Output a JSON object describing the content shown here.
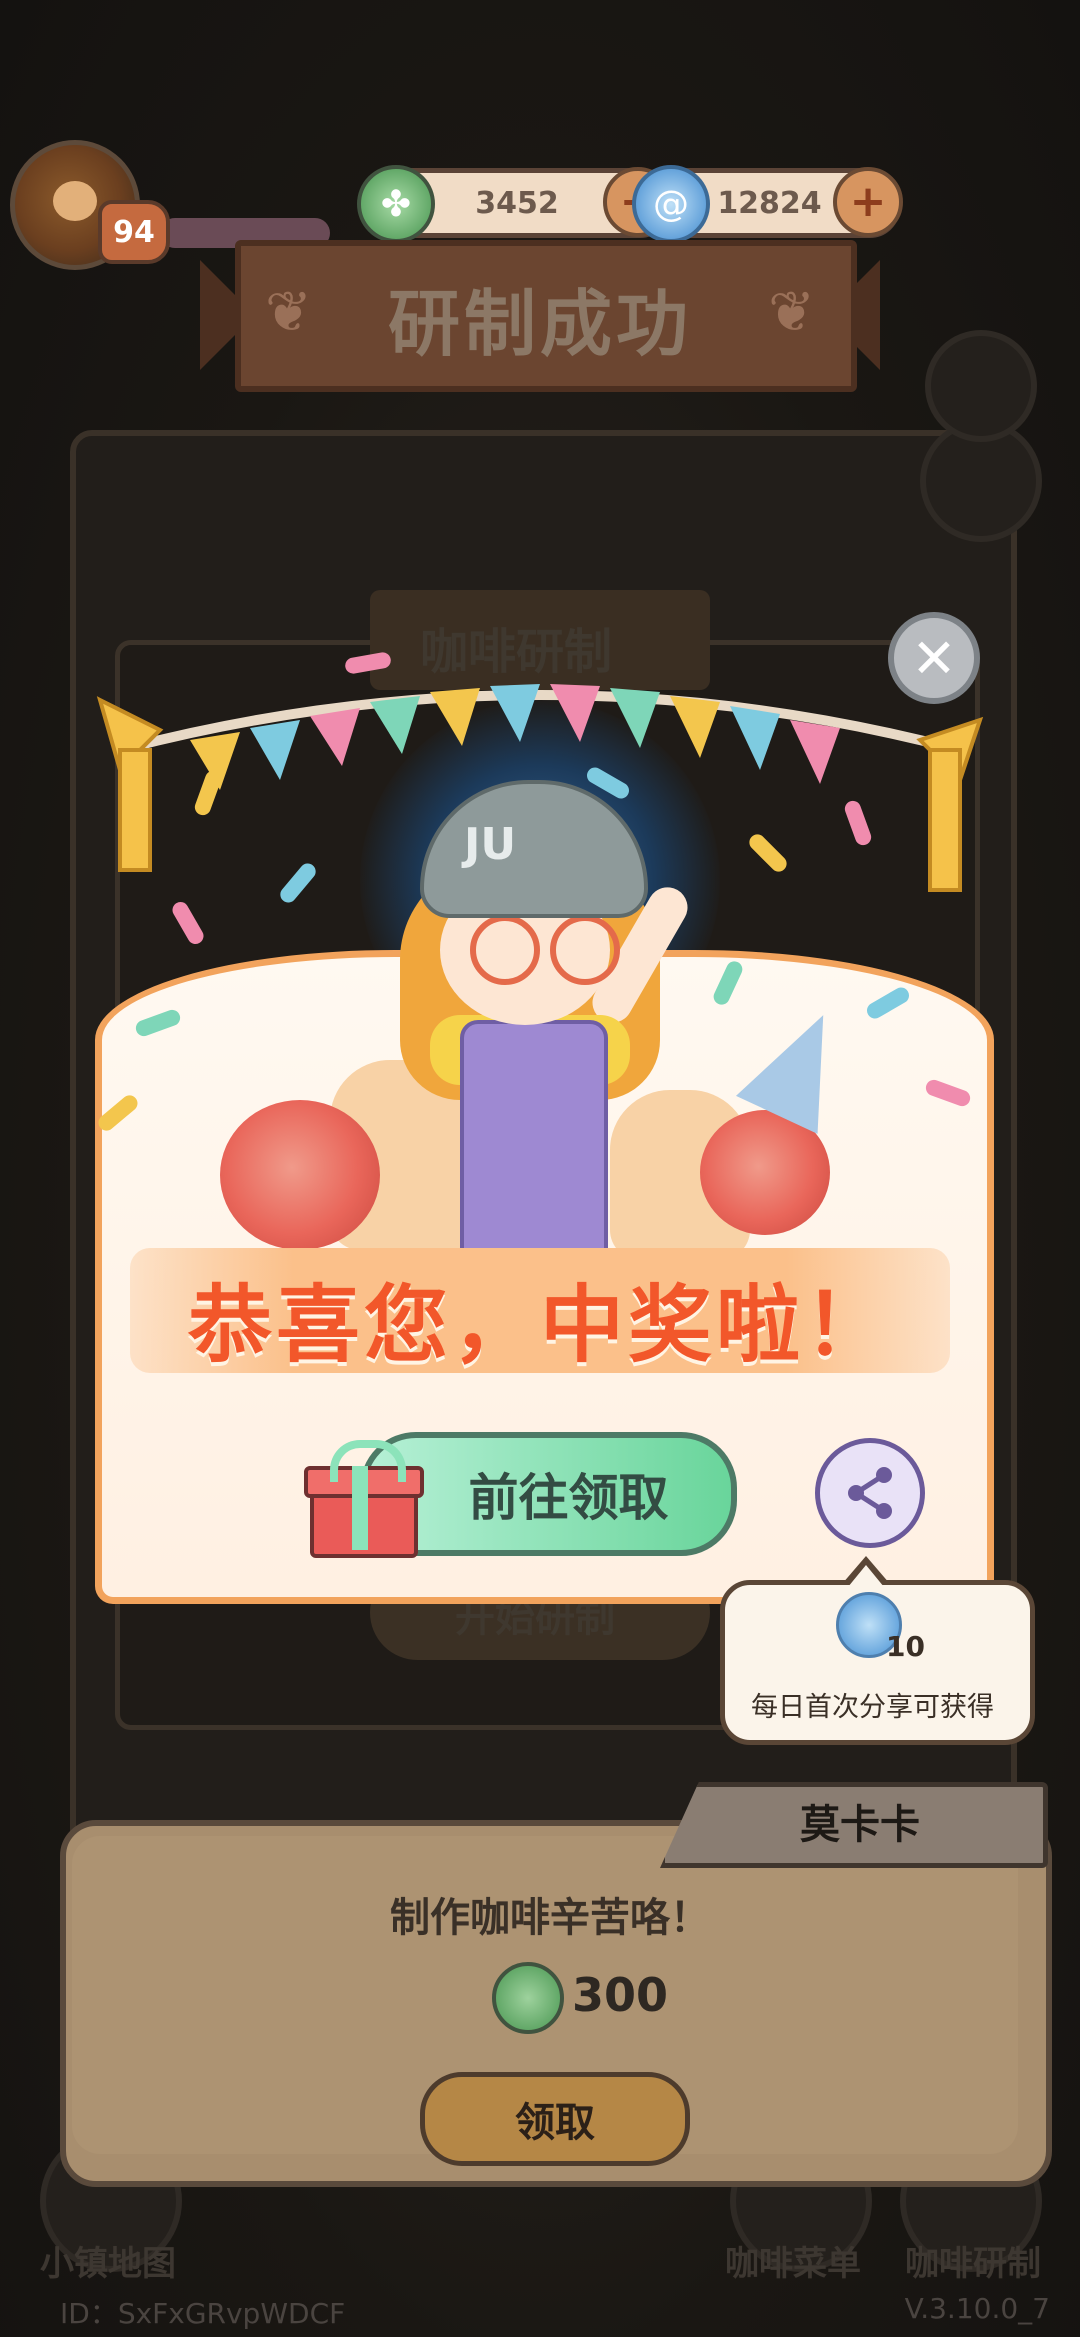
{
  "hud": {
    "level": "94",
    "currency_clover": "3452",
    "currency_swirl": "12824"
  },
  "banner": {
    "title": "研制成功"
  },
  "background": {
    "panel_title": "咖啡研制",
    "start_button": "开始研制",
    "nav_map": "小镇地图",
    "nav_menu": "咖啡菜单",
    "nav_research": "咖啡研制",
    "user_id": "ID：SxFxGRvpWDCF",
    "version": "V.3.10.0_7"
  },
  "popup": {
    "congrats": "恭喜您，中奖啦！",
    "claim_button": "前往领取",
    "cap_text": "JU",
    "share_tip_count": "10",
    "share_tip_text": "每日首次分享可获得"
  },
  "dialog": {
    "speaker": "莫卡卡",
    "message": "制作咖啡辛苦咯！",
    "reward_value": "300",
    "receive_button": "领取"
  },
  "colors": {
    "banner": "#6b4530",
    "popup_border": "#f2a35c",
    "congrats_text": "#f2572a",
    "claim_button": "#69d59b",
    "dialog_bg": "#a88e6e"
  }
}
